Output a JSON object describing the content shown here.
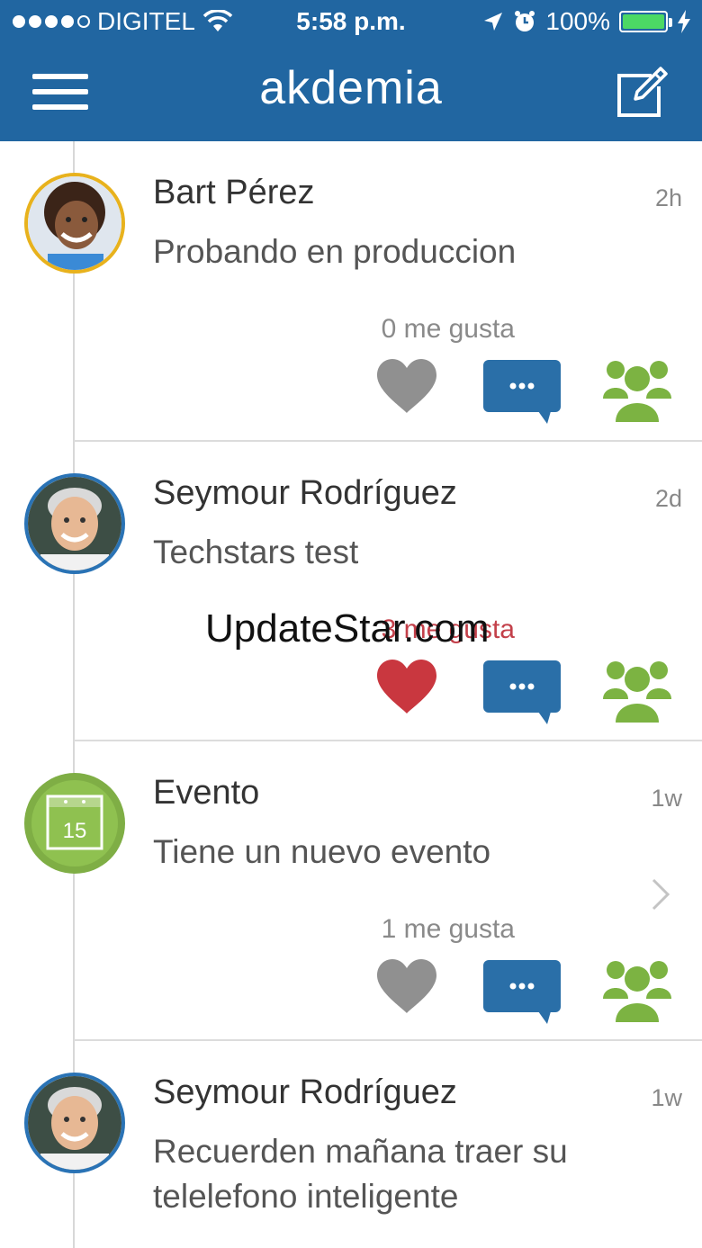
{
  "status_bar": {
    "carrier": "DIGITEL",
    "time": "5:58 p.m.",
    "battery": "100%"
  },
  "header": {
    "title": "akdemia",
    "menu_icon": "hamburger-menu-icon",
    "compose_icon": "compose-icon"
  },
  "posts": [
    {
      "author": "Bart Pérez",
      "time": "2h",
      "message": "Probando en produccion",
      "likes": "0 me gusta",
      "liked": false
    },
    {
      "author": "Seymour Rodríguez",
      "time": "2d",
      "message": "Techstars test",
      "likes": "3 me gusta",
      "liked": true
    },
    {
      "author": "Evento",
      "time": "1w",
      "message": "Tiene un nuevo evento",
      "likes": "1 me gusta",
      "liked": false,
      "calendar_day": "15"
    },
    {
      "author": "Seymour Rodríguez",
      "time": "1w",
      "message": "Recuerden mañana traer su telelefono inteligente"
    }
  ],
  "watermark": "UpdateStar.com",
  "colors": {
    "header": "#2166a1",
    "heart_liked": "#c9373f",
    "heart_default": "#909090",
    "comment": "#2a6fa8",
    "group": "#7cb342",
    "event_ring": "#7fae45"
  }
}
